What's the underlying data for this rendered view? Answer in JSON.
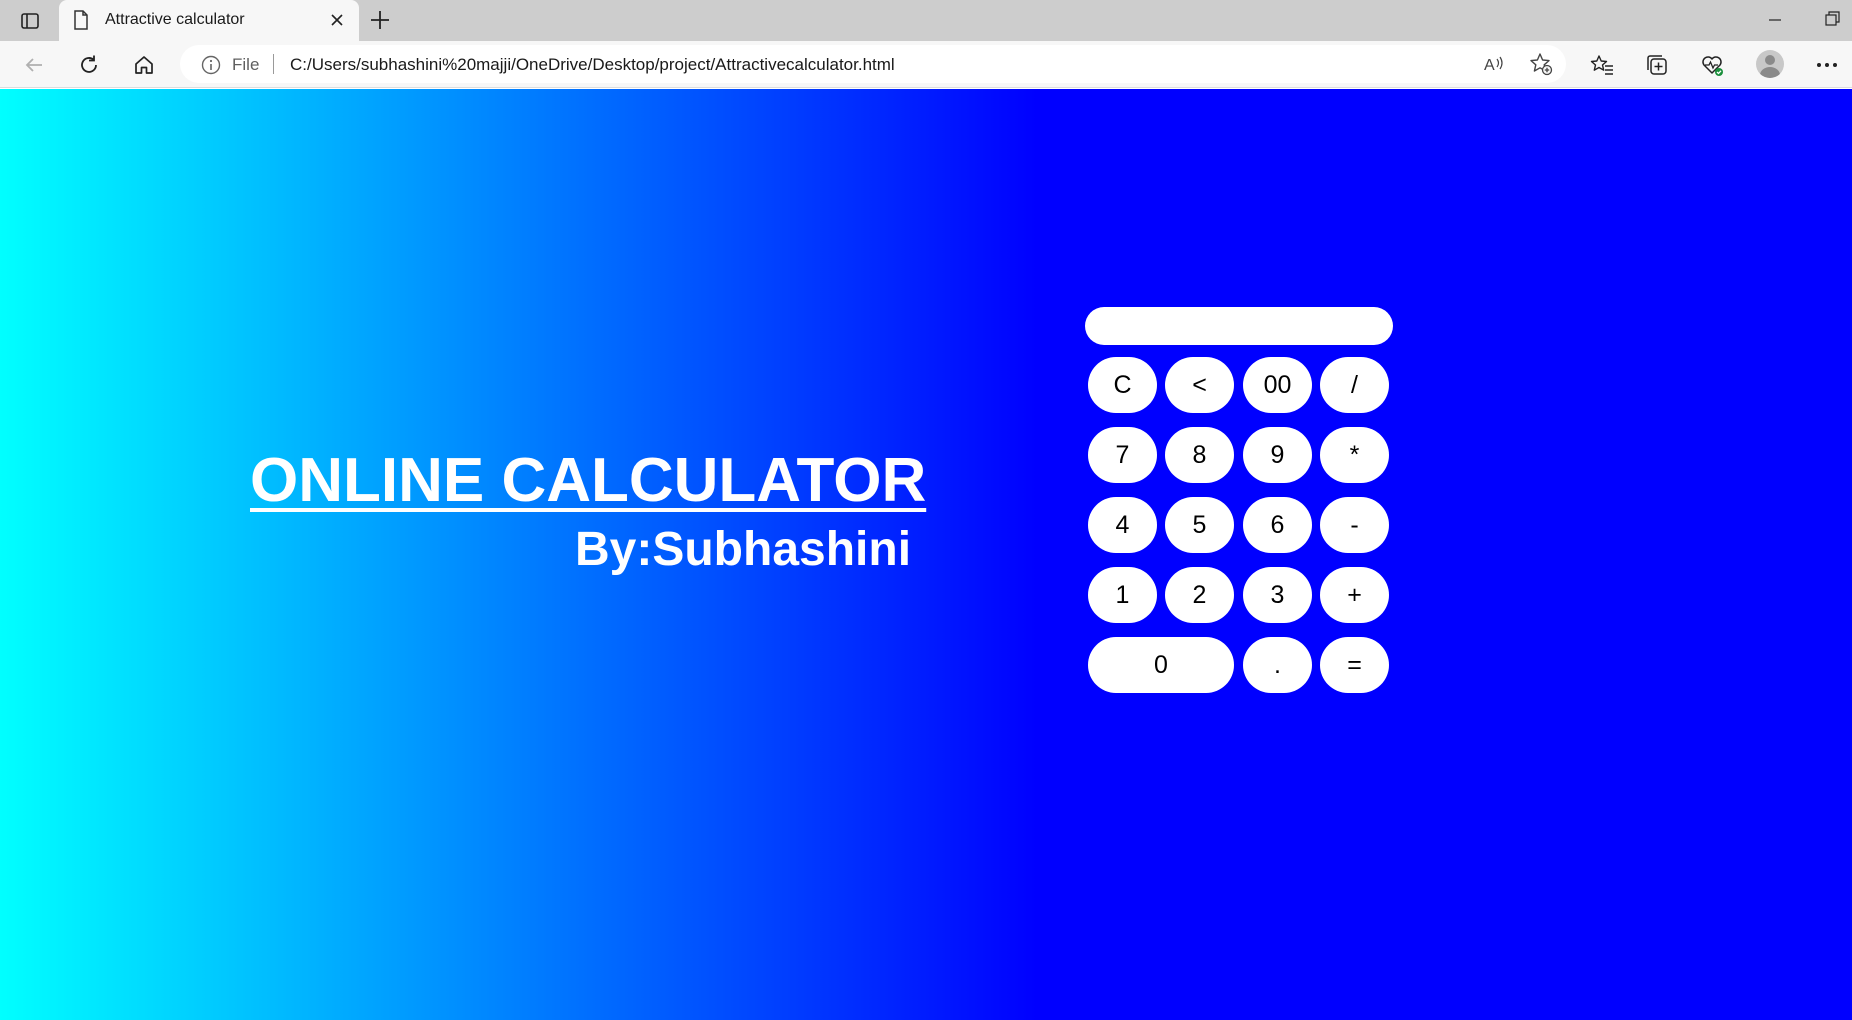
{
  "browser": {
    "tab_title": "Attractive calculator",
    "address_scheme_label": "File",
    "url": "C:/Users/subhashini%20majji/OneDrive/Desktop/project/Attractivecalculator.html"
  },
  "page": {
    "heading": "ONLINE CALCULATOR",
    "byline": "By:Subhashini",
    "display_value": "",
    "keys": {
      "clear": "C",
      "backspace": "<",
      "double_zero": "00",
      "divide": "/",
      "seven": "7",
      "eight": "8",
      "nine": "9",
      "multiply": "*",
      "four": "4",
      "five": "5",
      "six": "6",
      "subtract": "-",
      "one": "1",
      "two": "2",
      "three": "3",
      "add": "+",
      "zero": "0",
      "decimal": ".",
      "equals": "="
    }
  },
  "colors": {
    "gradient_start": "#00ffff",
    "gradient_end": "#0000ff",
    "text": "#ffffff",
    "button_bg": "#ffffff"
  }
}
